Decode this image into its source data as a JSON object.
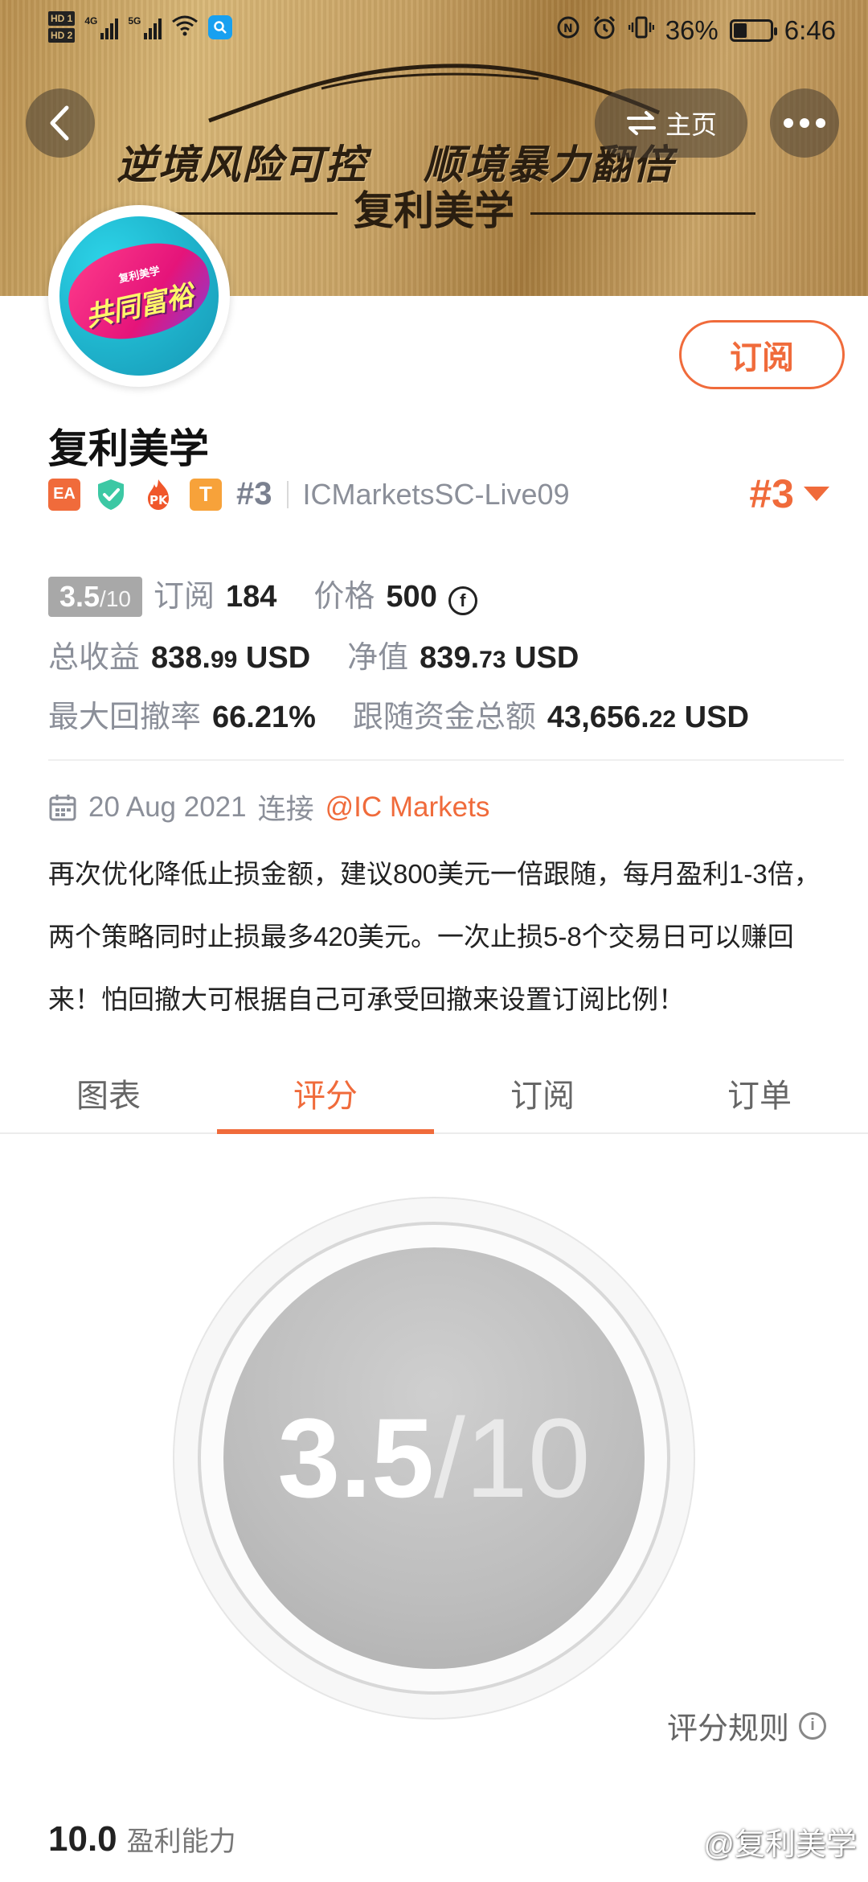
{
  "status_bar": {
    "network_left": "4G",
    "network_right": "5G",
    "hd_labels": [
      "HD 1",
      "HD 2"
    ],
    "battery": "36%",
    "battery_level": 0.36,
    "time": "6:46"
  },
  "banner": {
    "slogan_left": "逆境风险可控",
    "slogan_right": "顺境暴力翻倍",
    "subtitle": "复利美学"
  },
  "nav": {
    "home_label": "主页"
  },
  "avatar": {
    "top_text": "复利美学",
    "main_text": "共同富裕"
  },
  "subscribe_label": "订阅",
  "profile": {
    "name": "复利美学",
    "badges": {
      "ea": "EA",
      "pk": "PK",
      "t": "T"
    },
    "rank_small": "#3",
    "account": "ICMarketsSC-Live09",
    "rank_big": "#3"
  },
  "stats": {
    "score_main": "3.5",
    "score_den": "/10",
    "subs_label": "订阅",
    "subs_value": "184",
    "price_label": "价格",
    "price_value": "500",
    "total_profit_label": "总收益",
    "total_profit_main": "838.",
    "total_profit_dec": "99",
    "total_profit_unit": "USD",
    "equity_label": "净值",
    "equity_main": "839.",
    "equity_dec": "73",
    "equity_unit": "USD",
    "drawdown_label": "最大回撤率",
    "drawdown_value": "66.21%",
    "follow_label": "跟随资金总额",
    "follow_main": "43,656.",
    "follow_dec": "22",
    "follow_unit": "USD"
  },
  "info": {
    "date": "20 Aug 2021",
    "connect_label": "连接",
    "broker": "@IC Markets",
    "description": "再次优化降低止损金额，建议800美元一倍跟随，每月盈利1-3倍，两个策略同时止损最多420美元。一次止损5-8个交易日可以赚回来！怕回撤大可根据自己可承受回撤来设置订阅比例！"
  },
  "tabs": [
    {
      "label": "图表"
    },
    {
      "label": "评分"
    },
    {
      "label": "订阅"
    },
    {
      "label": "订单"
    }
  ],
  "active_tab": "评分",
  "gauge": {
    "score_main": "3.5",
    "score_den": "/10"
  },
  "rules_label": "评分规则",
  "metric": {
    "value": "10.0",
    "label": "盈利能力"
  },
  "watermark": "@复利美学",
  "colors": {
    "accent": "#f06b3b",
    "score_gray": "#a8a8a8",
    "banner_gold": "#c7a163"
  }
}
